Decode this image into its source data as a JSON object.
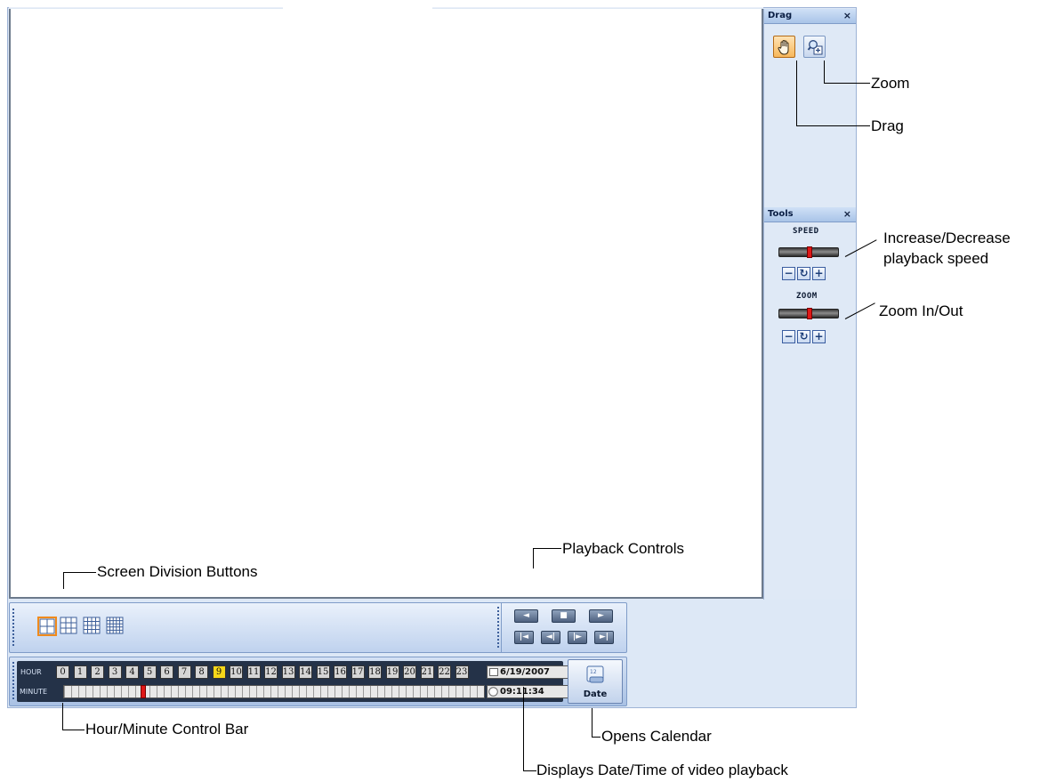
{
  "panels": {
    "drag": {
      "title": "Drag",
      "close": "×"
    },
    "tools": {
      "title": "Tools",
      "close": "×",
      "speed_label": "SPEED",
      "zoom_label": "ZOOM",
      "minus": "−",
      "reset": "↻",
      "plus": "+"
    }
  },
  "playback": {
    "prev": "◄",
    "stop": "■",
    "play": "►",
    "first": "|◄",
    "back": "◄|",
    "fwd": "|►",
    "last": "►|"
  },
  "timebar": {
    "hour_label": "HOUR",
    "minute_label": "MINUTE",
    "hours": [
      "0",
      "1",
      "2",
      "3",
      "4",
      "5",
      "6",
      "7",
      "8",
      "9",
      "10",
      "11",
      "12",
      "13",
      "14",
      "15",
      "16",
      "17",
      "18",
      "19",
      "20",
      "21",
      "22",
      "23"
    ],
    "selected_hour": "9",
    "date": "6/19/2007",
    "time": "09:11:34",
    "date_button": "Date"
  },
  "annotations": {
    "zoom": "Zoom",
    "drag": "Drag",
    "speed": "Increase/Decrease",
    "speed2": "playback speed",
    "zoom_io": "Zoom In/Out",
    "playback_controls": "Playback Controls",
    "screen_division": "Screen Division Buttons",
    "hour_minute": "Hour/Minute Control Bar",
    "opens_calendar": "Opens Calendar",
    "displays_datetime": "Displays Date/Time of video playback"
  },
  "colors": {
    "accent": "#f08a1c",
    "selected_hour": "#f6d81a",
    "slider_thumb": "#e01818",
    "panel_bg": "#dfe9f6"
  }
}
